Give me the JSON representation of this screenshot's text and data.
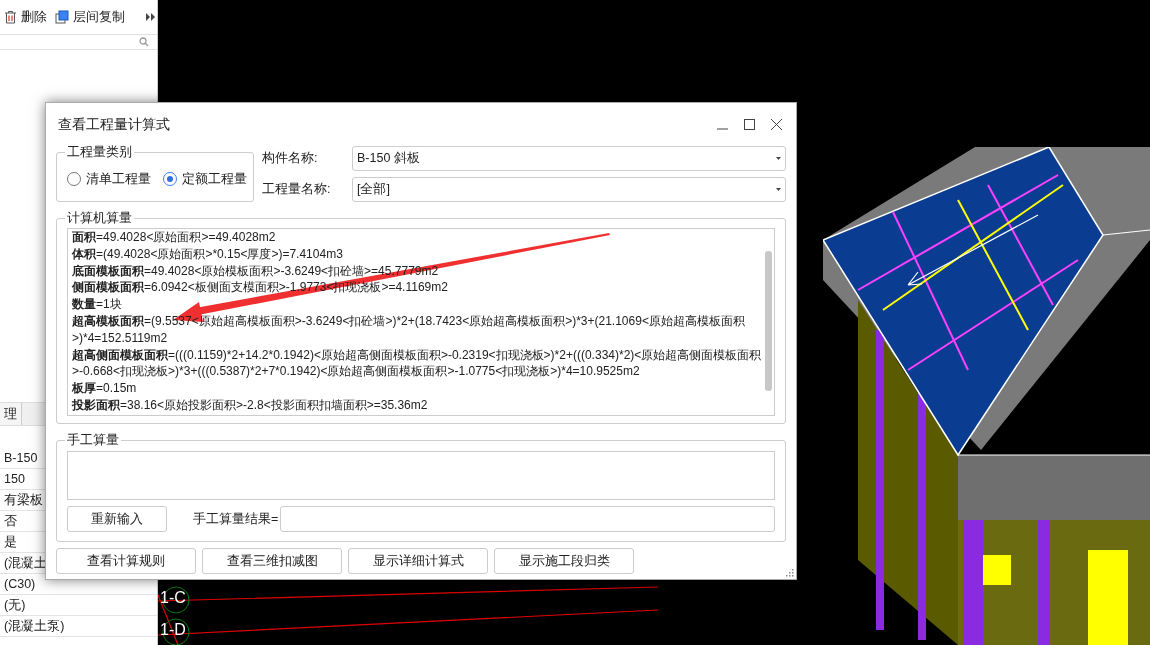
{
  "toolbar": [
    {
      "kind": "delete",
      "label": "删除"
    },
    {
      "kind": "copy",
      "label": "层间复制"
    }
  ],
  "left_panel": {
    "tab": "理",
    "rows": [
      "B-150",
      "150",
      "有梁板",
      "否",
      "是",
      "(混凝土",
      "(C30)",
      "(无)",
      "(混凝土泵)"
    ]
  },
  "canvas": {
    "axis_labels": [
      "1-C",
      "1-D"
    ]
  },
  "dialog": {
    "title": "查看工程量计算式",
    "quantity_type": {
      "legend": "工程量类别",
      "options": [
        {
          "label": "清单工程量",
          "selected": false
        },
        {
          "label": "定额工程量",
          "selected": true
        }
      ]
    },
    "fields": [
      {
        "label": "构件名称:",
        "value": "B-150 斜板"
      },
      {
        "label": "工程量名称:",
        "value": "[全部]"
      }
    ],
    "computed": {
      "legend": "计算机算量",
      "lines": [
        "**面积**=49.4028<原始面积>=49.4028m2",
        "**体积**=(49.4028<原始面积>*0.15<厚度>)=7.4104m3",
        "**底面模板面积**=49.4028<原始模板面积>-3.6249<扣砼墙>=45.7779m2",
        "**侧面模板面积**=6.0942<板侧面支模面积>-1.9773<扣现浇板>=4.1169m2",
        "**数量**=1块",
        "**超高模板面积**=(9.5537<原始超高模板面积>-3.6249<扣砼墙>)*2+(18.7423<原始超高模板面积>)*3+(21.1069<原始超高模板面积>)*4=152.5119m2",
        "**超高侧面模板面积**=(((0.1159)*2+14.2*0.1942)<原始超高侧面模板面积>-0.2319<扣现浇板>)*2+(((0.334)*2)<原始超高侧面模板面积>-0.668<扣现浇板>)*3+(((0.5387)*2+7*0.1942)<原始超高侧面模板面积>-1.0775<扣现浇板>)*4=10.9525m2",
        "**板厚**=0.15m",
        "**投影面积**=38.16<原始投影面积>-2.8<投影面积扣墙面积>=35.36m2"
      ]
    },
    "manual": {
      "legend": "手工算量",
      "reset_button": "重新输入",
      "result_label": "手工算量结果="
    },
    "buttons": [
      "查看计算规则",
      "查看三维扣减图",
      "显示详细计算式",
      "显示施工段归类"
    ]
  }
}
